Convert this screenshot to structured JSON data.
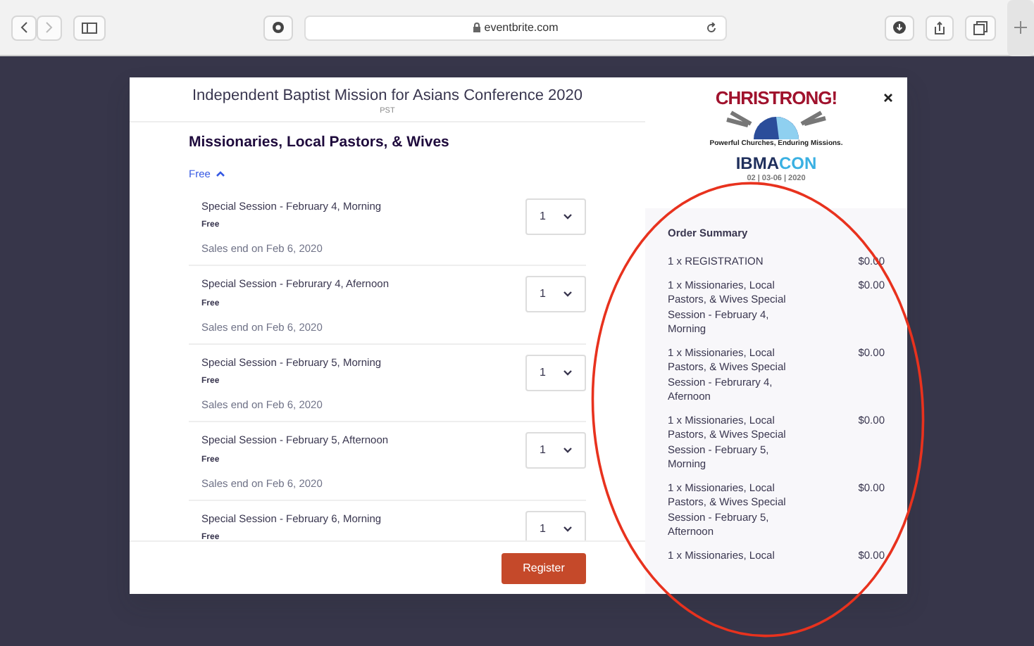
{
  "browser": {
    "url": "eventbrite.com"
  },
  "modal": {
    "title": "Independent Baptist Mission for Asians Conference 2020",
    "timezone": "PST",
    "ticket_group": {
      "name": "Missionaries, Local Pastors, & Wives",
      "price_toggle": "Free",
      "expanded": true
    },
    "tickets": [
      {
        "name": "Special Session - February 4, Morning",
        "price": "Free",
        "sales_end": "Sales end on Feb 6, 2020",
        "quantity": "1"
      },
      {
        "name": "Special Session - Februrary 4, Afernoon",
        "price": "Free",
        "sales_end": "Sales end on Feb 6, 2020",
        "quantity": "1"
      },
      {
        "name": "Special Session - February 5, Morning",
        "price": "Free",
        "sales_end": "Sales end on Feb 6, 2020",
        "quantity": "1"
      },
      {
        "name": "Special Session - February 5, Afternoon",
        "price": "Free",
        "sales_end": "Sales end on Feb 6, 2020",
        "quantity": "1"
      },
      {
        "name": "Special Session - February 6, Morning",
        "price": "Free",
        "quantity": "1"
      }
    ],
    "register_button": "Register",
    "logo": {
      "headline": "CHRISTRONG!",
      "tagline": "Powerful Churches, Enduring Missions.",
      "brand_dark": "IBMA",
      "brand_light": "CON",
      "dates": "02 | 03-06 | 2020"
    },
    "order_summary": {
      "title": "Order Summary",
      "items": [
        {
          "description": "1 x REGISTRATION",
          "price": "$0.00"
        },
        {
          "description": "1 x Missionaries, Local Pastors, & Wives Special Session - February 4, Morning",
          "price": "$0.00"
        },
        {
          "description": "1 x Missionaries, Local Pastors, & Wives Special Session - Februrary 4, Afernoon",
          "price": "$0.00"
        },
        {
          "description": "1 x Missionaries, Local Pastors, & Wives Special Session - February 5, Morning",
          "price": "$0.00"
        },
        {
          "description": "1 x Missionaries, Local Pastors, & Wives Special Session - February 5, Afternoon",
          "price": "$0.00"
        },
        {
          "description": "1 x Missionaries, Local",
          "price": "$0.00"
        }
      ]
    }
  },
  "annotation": {
    "kind": "ellipse",
    "color": "#e8321e"
  }
}
